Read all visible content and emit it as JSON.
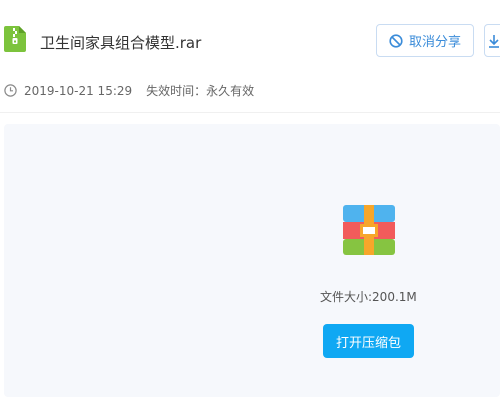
{
  "file": {
    "name": "卫生间家具组合模型.rar",
    "date": "2019-10-21 15:29",
    "expire_label": "失效时间：永久有效",
    "size_label": "文件大小:200.1M"
  },
  "actions": {
    "cancel_share_label": "取消分享",
    "open_archive_label": "打开压缩包"
  },
  "colors": {
    "accent": "#3b8cd9",
    "primary_button": "#0fa8f3",
    "file_icon_green": "#7cc33c"
  },
  "icons": {
    "file": "zip-file-icon",
    "cancel": "ban-icon",
    "clock": "clock-icon",
    "archive": "archive-icon"
  }
}
